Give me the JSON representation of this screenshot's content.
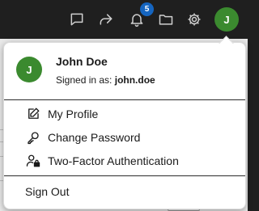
{
  "topbar": {
    "icons": [
      "message-icon",
      "share-icon",
      "bell-icon",
      "folder-icon",
      "gear-icon"
    ],
    "notification_count": "5",
    "avatar_initial": "J"
  },
  "user_menu": {
    "avatar_initial": "J",
    "user_name": "John Doe",
    "signed_in_prefix": "Signed in as:",
    "username": "john.doe",
    "items": [
      {
        "label": "My Profile",
        "icon": "edit-icon"
      },
      {
        "label": "Change Password",
        "icon": "key-icon"
      },
      {
        "label": "Two-Factor Authentication",
        "icon": "user-lock-icon"
      }
    ],
    "sign_out_label": "Sign Out"
  },
  "colors": {
    "topbar_bg": "#1f1f1f",
    "avatar_green": "#3b8a2f",
    "badge_blue": "#1565c0"
  }
}
